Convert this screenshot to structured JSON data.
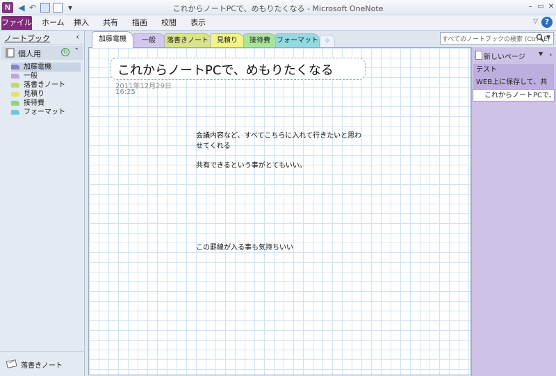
{
  "window": {
    "title": "これからノートPCで、めもりたくなる - Microsoft OneNote",
    "app_icon_letter": "N"
  },
  "ribbon": {
    "file": "ファイル",
    "tabs": [
      "ホーム",
      "挿入",
      "共有",
      "描画",
      "校閲",
      "表示"
    ]
  },
  "nav": {
    "header": "ノートブック",
    "collapse_glyph": "‹",
    "notebook": "個人用",
    "sections": [
      {
        "label": "加藤電機",
        "color": "#8a7fc9"
      },
      {
        "label": "一般",
        "color": "#b8a8df"
      },
      {
        "label": "落書きノート",
        "color": "#c8d66a"
      },
      {
        "label": "見積り",
        "color": "#e2e36c"
      },
      {
        "label": "接待費",
        "color": "#8cd67f"
      },
      {
        "label": "フォーマット",
        "color": "#6ccbd5"
      }
    ],
    "unfiled": "落書きノート"
  },
  "section_tabs": [
    {
      "label": "加藤電機",
      "color": "#ffffff"
    },
    {
      "label": "一般",
      "color": "#d3c7ef"
    },
    {
      "label": "落書きノート",
      "color": "#d9e38a"
    },
    {
      "label": "見積り",
      "color": "#f2f287"
    },
    {
      "label": "接待費",
      "color": "#a8e597"
    },
    {
      "label": "フォーマット",
      "color": "#92dbe2"
    }
  ],
  "search": {
    "placeholder": "すべてのノートブックの検索 (Ctrl+E)"
  },
  "page": {
    "title": "これからノートPCで、めもりたくなる",
    "date": "2011年12月29日",
    "time": "16:25",
    "notes": [
      "会議内容など、すべてこちらに入れて行きたいと思わ",
      "せてくれる",
      "共有できるという事がとてもいい。",
      "この罫線が入る事も気持ちいい"
    ]
  },
  "page_pane": {
    "new_page": "新しいページ",
    "pages": [
      {
        "label": "テスト",
        "active": false
      },
      {
        "label": "WEB上に保存して、共",
        "active": false
      },
      {
        "label": "これからノートPCで、めも",
        "active": true
      }
    ]
  }
}
